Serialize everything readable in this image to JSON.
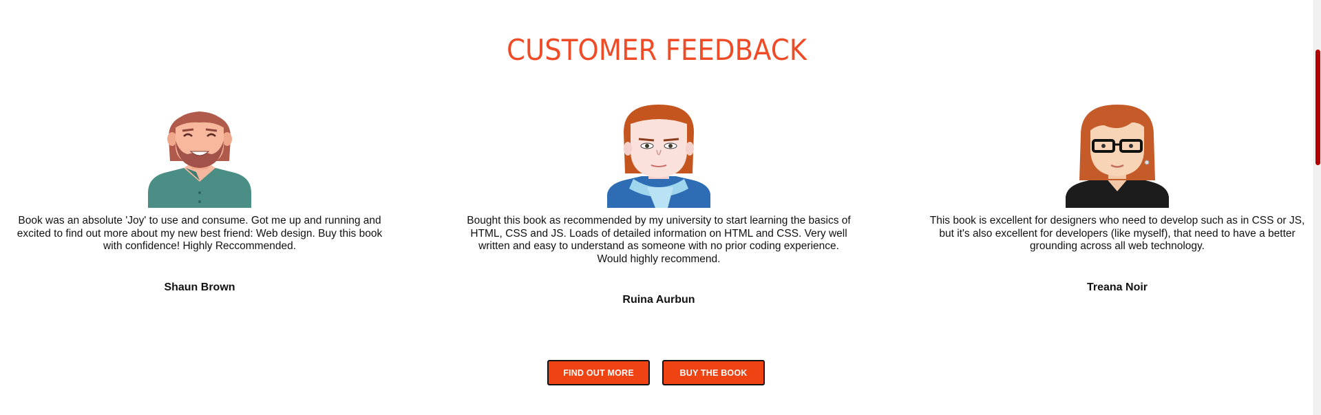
{
  "section": {
    "title": "CUSTOMER FEEDBACK"
  },
  "testimonials": [
    {
      "avatar_icon": "bearded-man-avatar-icon",
      "quote": "Book was an absolute 'Joy' to use and consume. Got me up and running and excited to find out more about my new best friend: Web design. Buy this book with confidence! Highly Reccommended.",
      "name": "Shaun Brown"
    },
    {
      "avatar_icon": "scarf-man-avatar-icon",
      "quote": "Bought this book as recommended by my university to start learning the basics of HTML, CSS and JS. Loads of detailed information on HTML and CSS. Very well written and easy to understand as someone with no prior coding experience. Would highly recommend.",
      "name": "Ruina Aurbun"
    },
    {
      "avatar_icon": "glasses-woman-avatar-icon",
      "quote": "This book is excellent for designers who need to develop such as in CSS or JS, but it's also excellent for developers (like myself), that need to have a better grounding across all web technology.",
      "name": "Treana Noir"
    }
  ],
  "buttons": {
    "find_out_more": "FIND OUT MORE",
    "buy_the_book": "BUY THE BOOK"
  },
  "colors": {
    "accent": "#ef4b27",
    "button": "#ef4313",
    "scroll_thumb": "#b30000"
  }
}
